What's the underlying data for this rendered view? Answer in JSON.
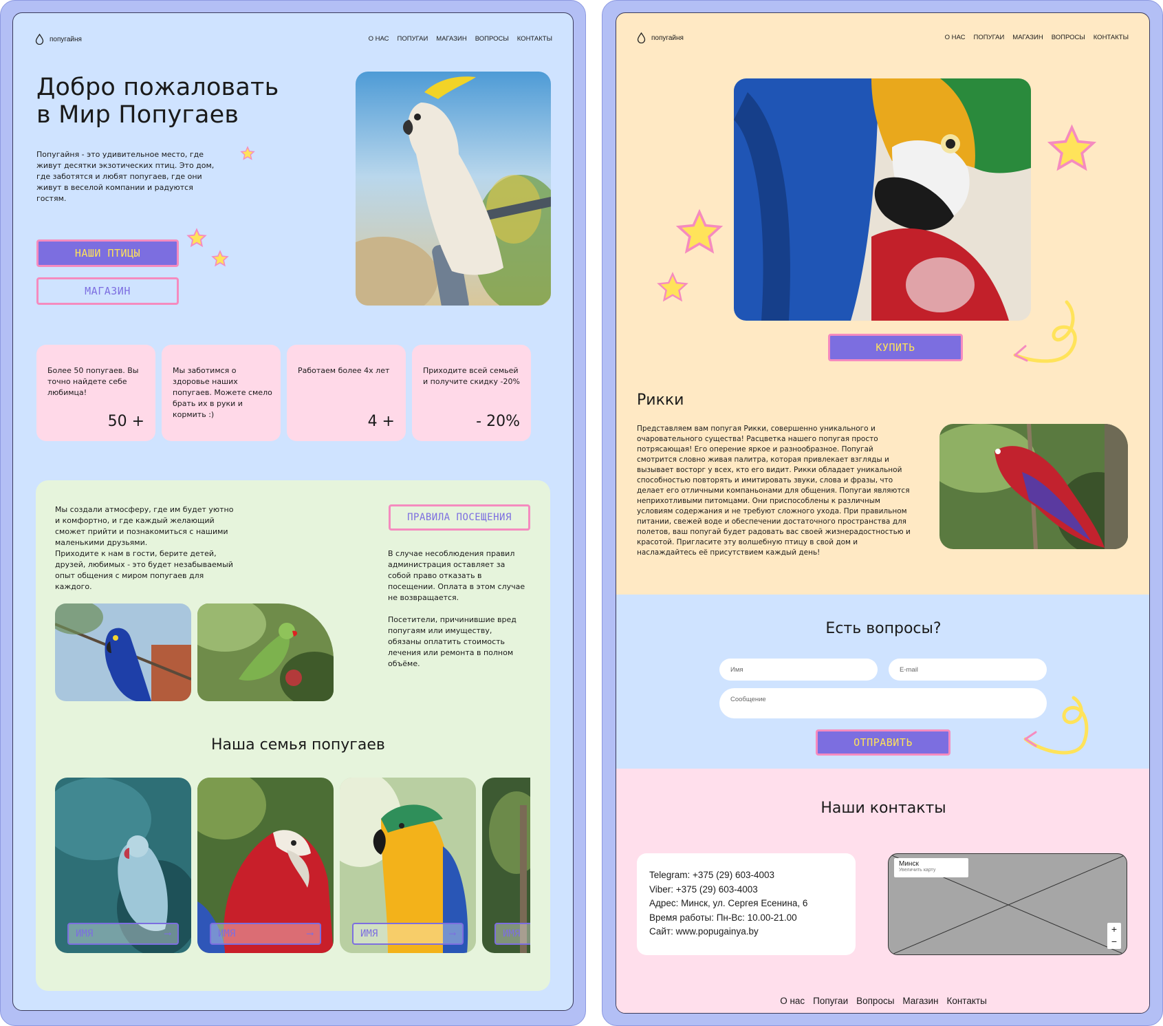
{
  "brand": "попугайня",
  "nav": [
    "О НАС",
    "ПОПУГАИ",
    "МАГАЗИН",
    "ВОПРОСЫ",
    "КОНТАКТЫ"
  ],
  "hero": {
    "title_line1": "Добро пожаловать",
    "title_line2": "в  Мир Попугаев",
    "text": "Попугайня - это удивительное место, где живут десятки экзотических птиц. Это дом, где заботятся и любят попугаев, где они живут в веселой компании и радуются гостям.",
    "btn_birds": "НАШИ ПТИЦЫ",
    "btn_shop": "МАГАЗИН"
  },
  "stats": [
    {
      "text": "Более 50 попугаев. Вы точно найдете себе любимца!",
      "num": "50 +"
    },
    {
      "text": "Мы заботимся о здоровье наших попугаев. Можете смело брать их в руки и кормить :)",
      "num": ""
    },
    {
      "text": "Работаем более 4х лет",
      "num": "4 +"
    },
    {
      "text": "Приходите всей семьей и получите скидку -20%",
      "num": "- 20%"
    }
  ],
  "about": {
    "text1": "Мы создали атмосферу, где им будет уютно и комфортно, и где каждый желающий сможет прийти и познакомиться с нашими маленькими друзьями.",
    "text2": "Приходите к нам в гости, берите детей, друзей, любимых - это будет незабываемый опыт общения с миром попугаев для каждого.",
    "rules_btn": "ПРАВИЛА ПОСЕЩЕНИЯ",
    "rules1": "В случае несоблюдения правил администрация оставляет за собой право отказать в посещении. Оплата в этом случае не возвращается.",
    "rules2": "Посетители, причинившие вред попугаям или имуществу, обязаны оплатить стоимость лечения или ремонта в полном объёме."
  },
  "family": {
    "title": "Наша семья попугаев",
    "name_label": "ИМЯ",
    "arrow": "⟶"
  },
  "product": {
    "buy": "КУПИТЬ",
    "name": "Рикки",
    "text": "Представляем вам попугая Рикки, совершенно уникального и очаровательного существа! Расцветка нашего попугая просто потрясающая! Его оперение яркое и разнообразное. Попугай смотрится словно живая палитра, которая привлекает взгляды и вызывает восторг у всех, кто его видит. Рикки обладает уникальной способностью повторять и имитировать звуки, слова и фразы, что делает его отличными компаньонами для общения. Попугаи являются неприхотливыми питомцами. Они приспособлены к различным условиям содержания и не требуют сложного ухода. При правильном питании, свежей воде и обеспечении достаточного пространства для полетов, ваш попугай будет радовать вас своей жизнерадостностью и красотой. Пригласите эту волшебную птицу в свой дом и наслаждайтесь её присутствием каждый день!"
  },
  "questions": {
    "title": "Есть вопросы?",
    "name_ph": "Имя",
    "email_ph": "E-mail",
    "message_ph": "Сообщение",
    "send": "ОТПРАВИТЬ"
  },
  "contacts": {
    "title": "Наши контакты",
    "lines": [
      "Telegram: +375 (29) 603-4003",
      "Viber: +375 (29) 603-4003",
      "Адрес: Минск, ул. Сергея Есенина, 6",
      "Время работы: Пн-Вс: 10.00-21.00",
      "Сайт: www.popugainya.by"
    ],
    "map_city": "Минск",
    "map_link": "Увеличить карту",
    "zoom_in": "+",
    "zoom_out": "−"
  },
  "footer": [
    "О нас",
    "Попугаи",
    "Вопросы",
    "Магазин",
    "Контакты"
  ],
  "colors": {
    "accent": "#7c6ee0",
    "pink": "#f58bbf",
    "yellow": "#ffe35a",
    "blue_bg": "#cfe3ff",
    "peach_bg": "#ffe9c4",
    "pink_bg": "#ffdfec",
    "green_bg": "#e6f4dc"
  }
}
